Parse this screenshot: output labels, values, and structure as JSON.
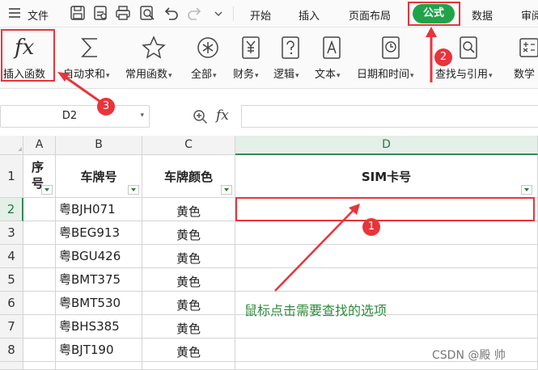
{
  "menubar": {
    "menu_label": "文件",
    "tabs": [
      "开始",
      "插入",
      "页面布局",
      "公式",
      "数据",
      "审阅"
    ]
  },
  "ribbon": {
    "insert_function": {
      "glyph": "fx",
      "label": "插入函数"
    },
    "items": [
      {
        "label": "自动求和",
        "icon": "sigma-icon"
      },
      {
        "label": "常用函数",
        "icon": "star-icon"
      },
      {
        "label": "全部",
        "icon": "asterisk-icon"
      },
      {
        "label": "财务",
        "icon": "yen-book-icon"
      },
      {
        "label": "逻辑",
        "icon": "question-book-icon"
      },
      {
        "label": "文本",
        "icon": "a-book-icon"
      },
      {
        "label": "日期和时间",
        "icon": "clock-book-icon"
      },
      {
        "label": "查找与引用",
        "icon": "magnifier-book-icon"
      },
      {
        "label": "数学",
        "icon": "math-icon"
      }
    ]
  },
  "formula_bar": {
    "cell_ref": "D2",
    "fx": "fx",
    "formula": ""
  },
  "grid": {
    "columns": [
      "A",
      "B",
      "C",
      "D"
    ],
    "row_numbers": [
      "1",
      "2",
      "3",
      "4",
      "5",
      "6",
      "7",
      "8"
    ],
    "header": {
      "a": "序号",
      "b": "车牌号",
      "c": "车牌颜色",
      "d": "SIM卡号"
    },
    "rows": [
      {
        "plate": "粤BJH071",
        "color": "黄色"
      },
      {
        "plate": "粤BEG913",
        "color": "黄色"
      },
      {
        "plate": "粤BGU426",
        "color": "黄色"
      },
      {
        "plate": "粤BMT375",
        "color": "黄色"
      },
      {
        "plate": "粤BMT530",
        "color": "黄色"
      },
      {
        "plate": "粤BHS385",
        "color": "黄色"
      },
      {
        "plate": "粤BJT190",
        "color": "黄色"
      }
    ]
  },
  "annotations": {
    "badges": [
      "1",
      "2",
      "3"
    ],
    "note": "鼠标点击需要查找的选项",
    "watermark": "CSDN @殿 帅"
  },
  "colors": {
    "accent_green": "#21a34a",
    "annotation_red": "#e8343a",
    "note_green": "#2e8b3a"
  }
}
